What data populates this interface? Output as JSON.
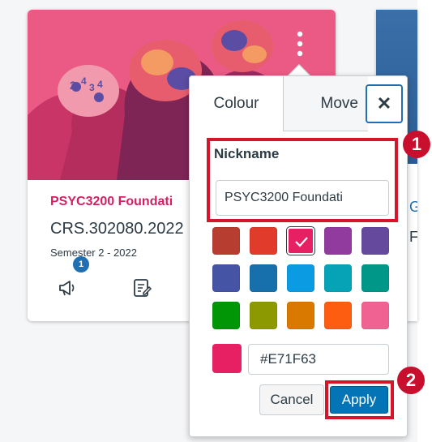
{
  "card": {
    "title": "PSYC3200 Foundati",
    "code": "CRS.302080.2022",
    "term": "Semester 2 - 2022",
    "announcement_badge": "1",
    "hero_color": "#e8527f"
  },
  "card2": {
    "letter_g": "G",
    "letter_f": "F"
  },
  "popover": {
    "tab_colour": "Colour",
    "tab_move": "Move",
    "close_glyph": "✕",
    "nickname_label": "Nickname",
    "nickname_value": "PSYC3200 Foundati",
    "swatches": [
      "#b63d2f",
      "#e13b2b",
      "#e71f63",
      "#913b9e",
      "#65499d",
      "#4554a4",
      "#1770ab",
      "#0b9be3",
      "#06a3b7",
      "#009688",
      "#009606",
      "#8d9900",
      "#d97900",
      "#fd5d10",
      "#f06291"
    ],
    "selected_swatch": "#e71f63",
    "hex_value": "#E71F63",
    "cancel_label": "Cancel",
    "apply_label": "Apply"
  },
  "steps": {
    "one": "1",
    "two": "2"
  }
}
